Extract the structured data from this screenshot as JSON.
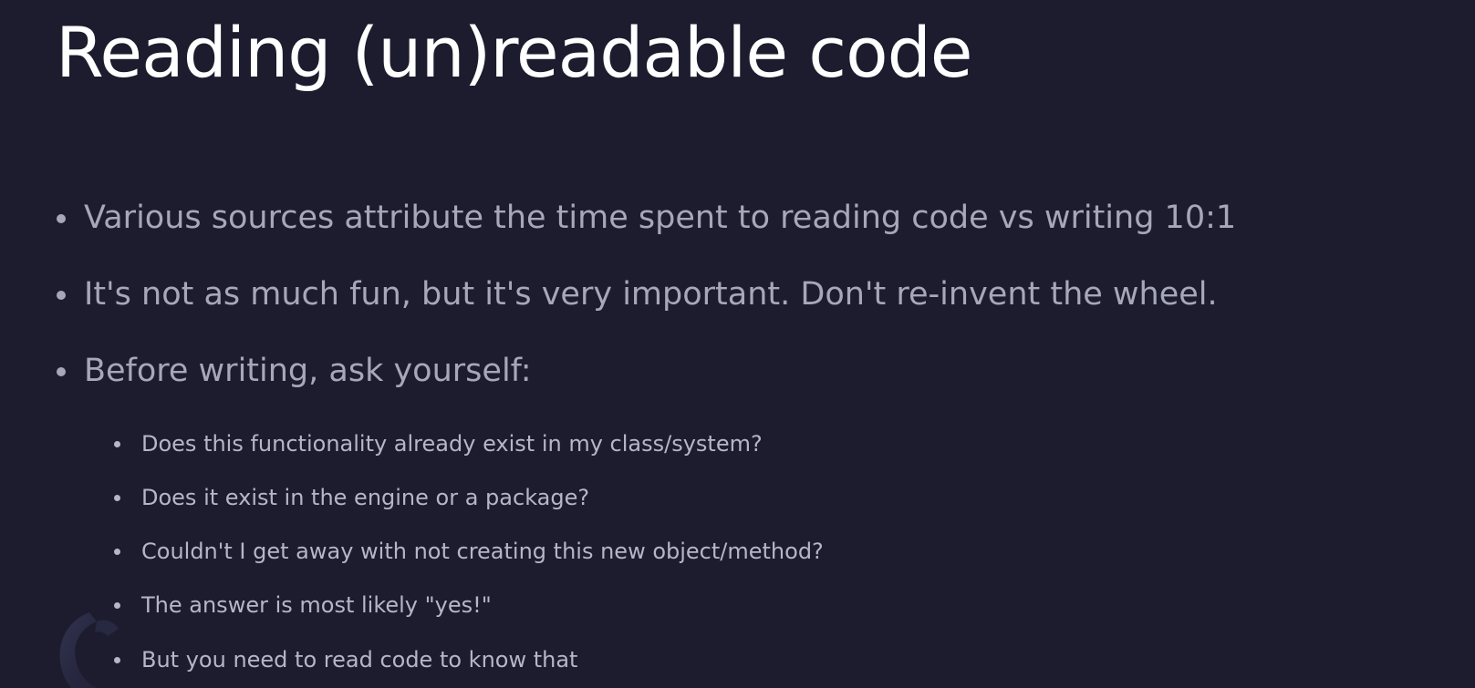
{
  "slide": {
    "title": "Reading (un)readable code",
    "bullets": [
      "Various sources attribute the time spent to reading code vs writing 10:1",
      "It's not as much fun, but it's very important. Don't re-invent the wheel.",
      "Before writing, ask yourself:"
    ],
    "sub_bullets": [
      "Does this functionality already exist in my class/system?",
      "Does it exist in the engine or a package?",
      "Couldn't I get away with not creating this new object/method?",
      "The answer is most likely \"yes!\"",
      "But you need to read code to know that"
    ]
  },
  "icons": {
    "bullet": "bullet-dot",
    "logo": "watermark-logo"
  },
  "colors": {
    "background": "#1c1c2e",
    "title": "#ffffff",
    "body_text": "#a6a7b8"
  }
}
